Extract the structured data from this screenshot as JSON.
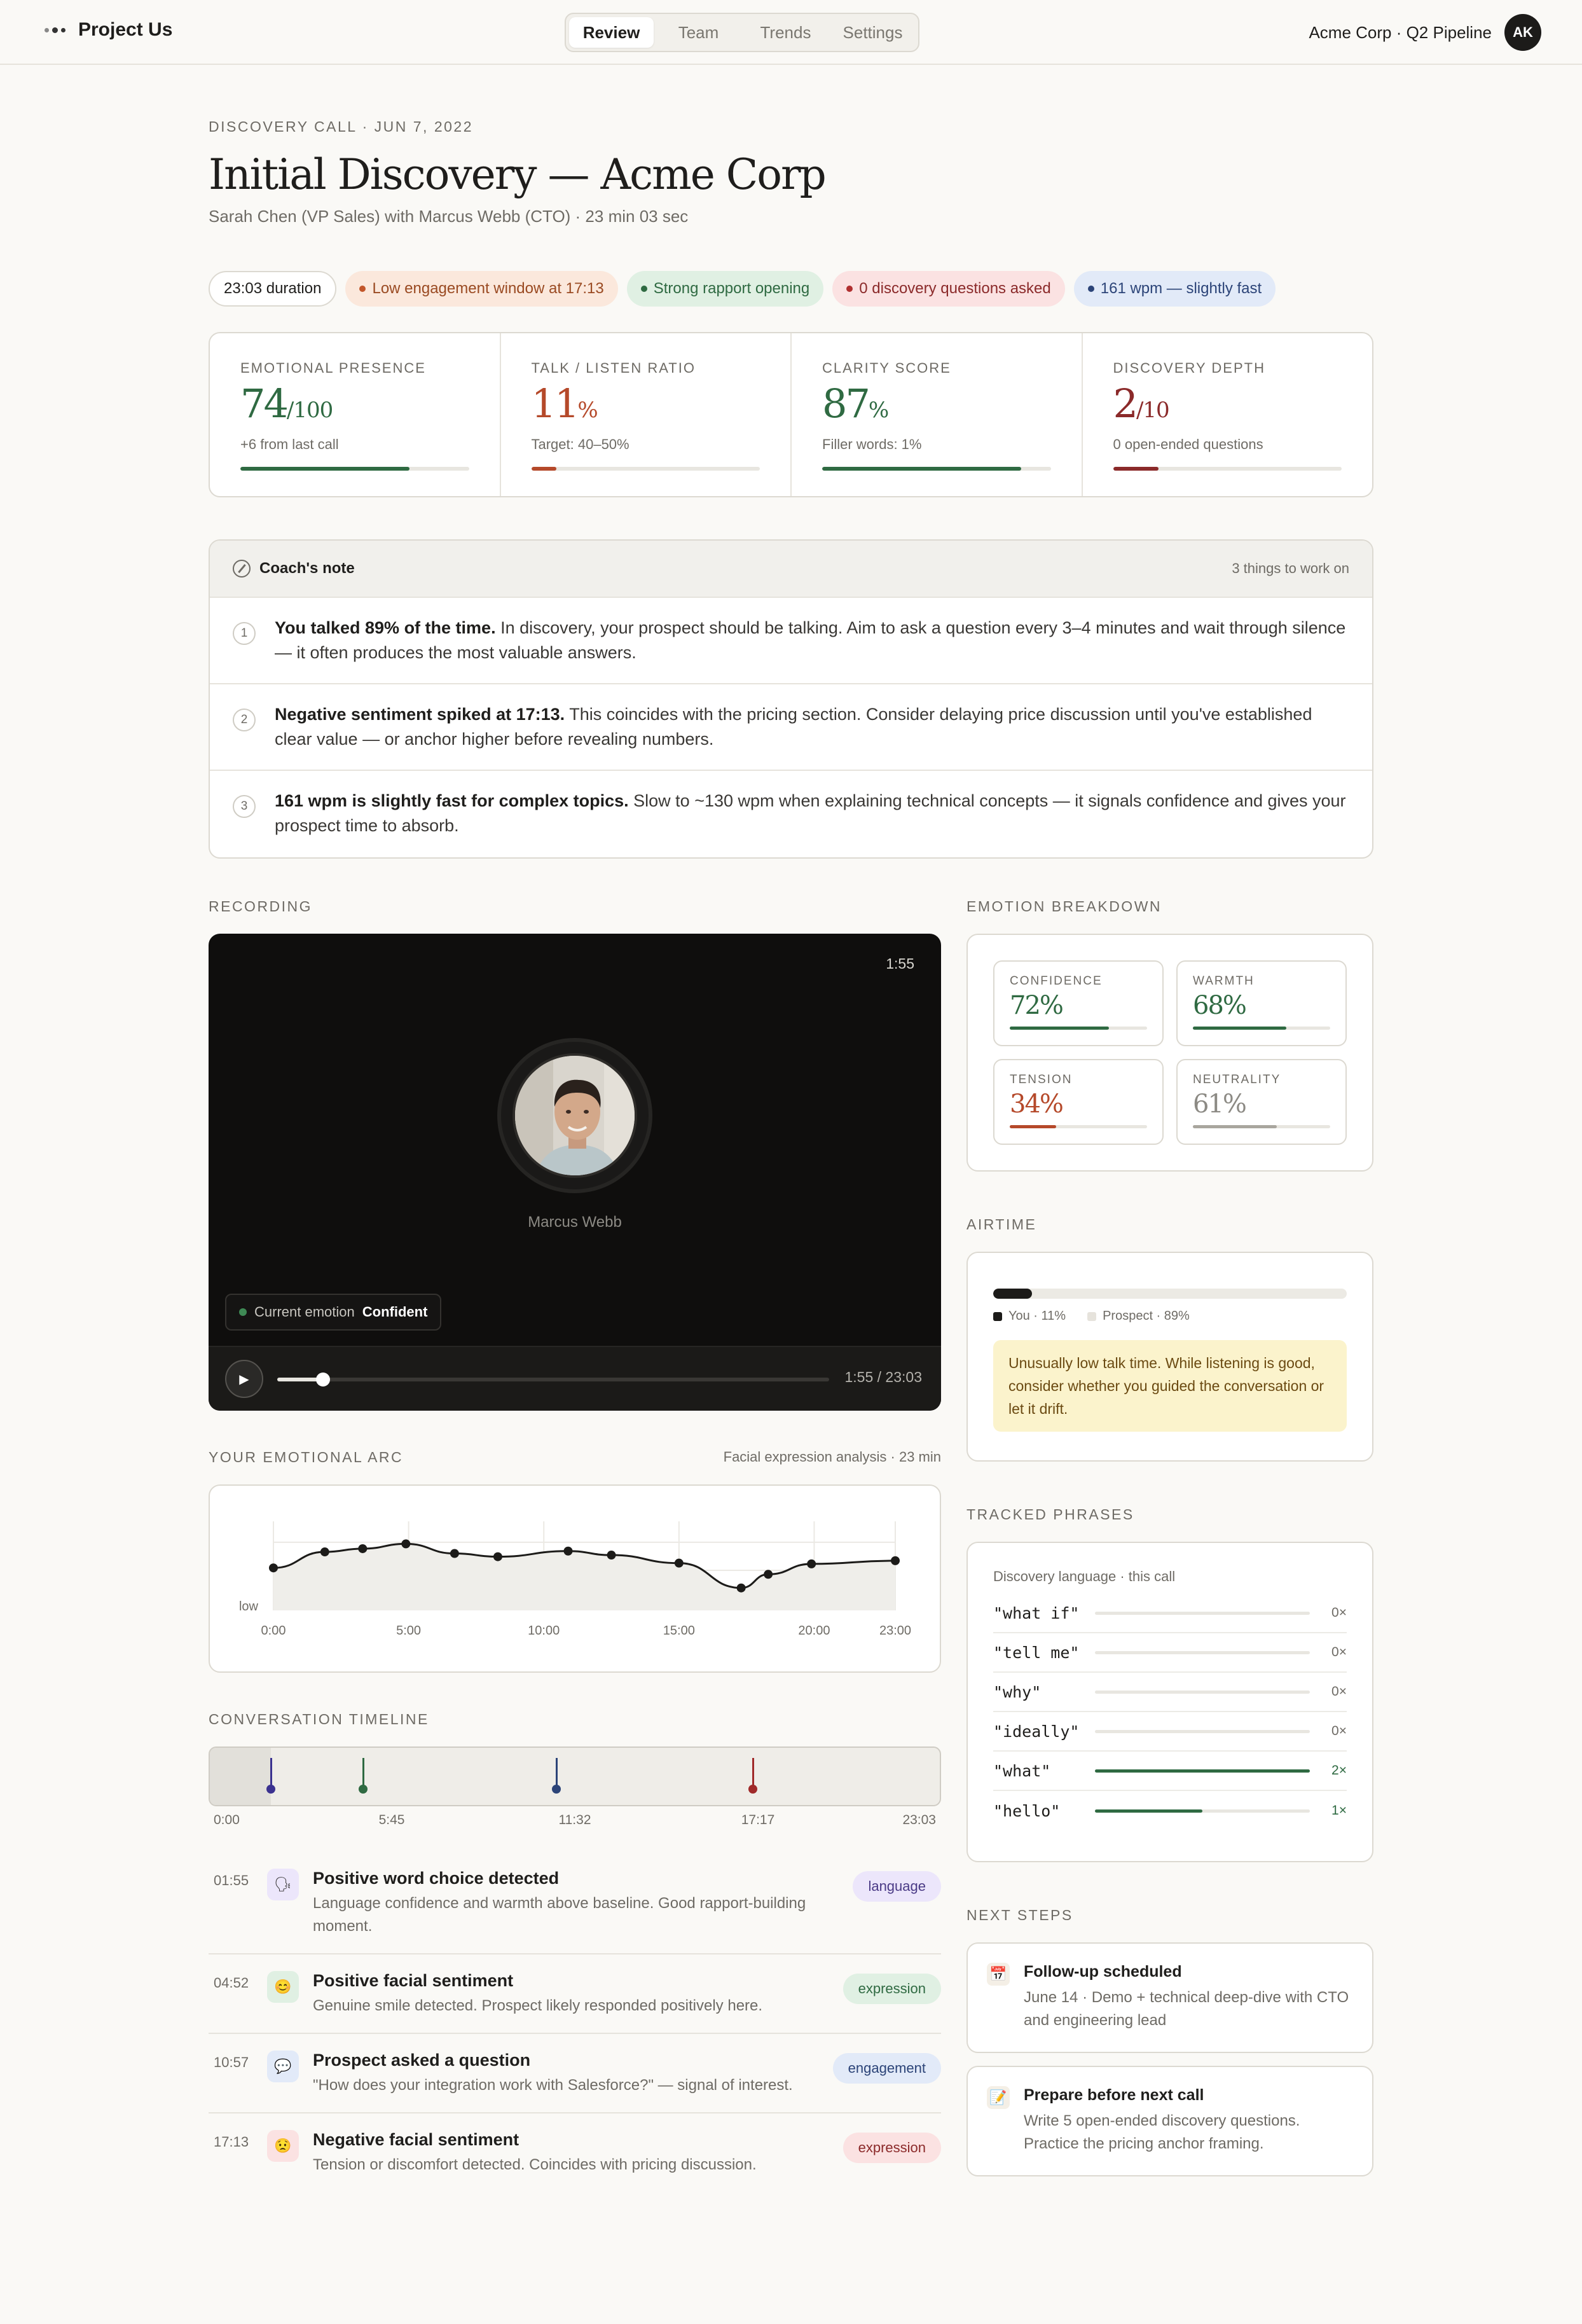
{
  "app": {
    "name": "Project Us",
    "crumb": "Acme Corp · Q2 Pipeline",
    "avatar": "AK"
  },
  "nav": {
    "tabs": [
      "Review",
      "Team",
      "Trends",
      "Settings"
    ],
    "active": "Review"
  },
  "header": {
    "eyebrow": "DISCOVERY CALL · JUN 7, 2022",
    "title": "Initial Discovery — Acme Corp",
    "subtitle": "Sarah Chen (VP Sales) with Marcus Webb (CTO) · 23 min 03 sec"
  },
  "pills": [
    {
      "label": "23:03 duration",
      "style": "plain"
    },
    {
      "label": "Low engagement window at 17:13",
      "style": "orange"
    },
    {
      "label": "Strong rapport opening",
      "style": "green"
    },
    {
      "label": "0 discovery questions asked",
      "style": "red"
    },
    {
      "label": "161 wpm — slightly fast",
      "style": "blue"
    }
  ],
  "metrics": [
    {
      "label": "EMOTIONAL PRESENCE",
      "value": "74",
      "unit": "/100",
      "sub": "+6 from last call",
      "color": "#2f6a42",
      "fill": 0.74
    },
    {
      "label": "TALK / LISTEN RATIO",
      "value": "11",
      "unit": "%",
      "sub": "Target: 40–50%",
      "color": "#b5492a",
      "fill": 0.11
    },
    {
      "label": "CLARITY SCORE",
      "value": "87",
      "unit": "%",
      "sub": "Filler words: 1%",
      "color": "#2f6a42",
      "fill": 0.87
    },
    {
      "label": "DISCOVERY DEPTH",
      "value": "2",
      "unit": "/10",
      "sub": "0 open-ended questions",
      "color": "#8b2a2a",
      "fill": 0.2
    }
  ],
  "coach": {
    "title": "Coach's note",
    "count": "3 things to work on",
    "tips": [
      {
        "num": "1",
        "bold": "You talked 89% of the time.",
        "text": " In discovery, your prospect should be talking. Aim to ask a question every 3–4 minutes and wait through silence — it often produces the most valuable answers."
      },
      {
        "num": "2",
        "bold": "Negative sentiment spiked at 17:13.",
        "text": " This coincides with the pricing section. Consider delaying price discussion until you've established clear value — or anchor higher before revealing numbers."
      },
      {
        "num": "3",
        "bold": "161 wpm is slightly fast for complex topics.",
        "text": " Slow to ~130 wpm when explaining technical concepts — it signals confidence and gives your prospect time to absorb."
      }
    ]
  },
  "recording": {
    "heading": "RECORDING",
    "corner_time": "1:55",
    "person": "Marcus Webb",
    "emotion_label": "Current emotion",
    "emotion_value": "Confident",
    "time_display": "1:55 / 23:03",
    "progress": 0.083
  },
  "arc": {
    "heading": "YOUR EMOTIONAL ARC",
    "aux": "Facial expression analysis · 23 min",
    "ylabel": "low"
  },
  "chart_data": {
    "type": "line",
    "title": "",
    "xlabel": "",
    "ylabel": "low",
    "x_ticks": [
      "0:00",
      "5:00",
      "10:00",
      "15:00",
      "20:00",
      "23:00"
    ],
    "xlim": [
      0,
      23
    ],
    "ylim": [
      0,
      1
    ],
    "x": [
      0,
      1.9,
      3.3,
      4.9,
      6.7,
      8.3,
      10.9,
      12.5,
      15.0,
      17.3,
      18.3,
      19.9,
      23.0
    ],
    "values": [
      0.53,
      0.73,
      0.77,
      0.83,
      0.71,
      0.67,
      0.74,
      0.69,
      0.59,
      0.28,
      0.45,
      0.58,
      0.62
    ]
  },
  "timeline": {
    "heading": "CONVERSATION TIMELINE",
    "labels": [
      "0:00",
      "5:45",
      "11:32",
      "17:17",
      "23:03"
    ],
    "markers": [
      {
        "pos": 0.084,
        "color": "#3b3290"
      },
      {
        "pos": 0.21,
        "color": "#2f6a42"
      },
      {
        "pos": 0.475,
        "color": "#2c4478"
      },
      {
        "pos": 0.744,
        "color": "#a02a2a"
      }
    ],
    "events": [
      {
        "time": "01:55",
        "icon": "speech-icon",
        "glyph": "🗣",
        "bg": "#ece6fb",
        "title": "Positive word choice detected",
        "desc": "Language confidence and warmth above baseline. Good rapport-building moment.",
        "tag": "language",
        "tagstyle": "t-lang"
      },
      {
        "time": "04:52",
        "icon": "smile-icon",
        "glyph": "😊",
        "bg": "#e0f0e3",
        "title": "Positive facial sentiment",
        "desc": "Genuine smile detected. Prospect likely responded positively here.",
        "tag": "expression",
        "tagstyle": "t-exp"
      },
      {
        "time": "10:57",
        "icon": "chat-icon",
        "glyph": "💬",
        "bg": "#e2eaf8",
        "title": "Prospect asked a question",
        "desc": "\"How does your integration work with Salesforce?\" — signal of interest.",
        "tag": "engagement",
        "tagstyle": "t-eng"
      },
      {
        "time": "17:13",
        "icon": "frown-icon",
        "glyph": "😟",
        "bg": "#fbe2e2",
        "title": "Negative facial sentiment",
        "desc": "Tension or discomfort detected. Coincides with pricing discussion.",
        "tag": "expression",
        "tagstyle": "t-expr"
      }
    ]
  },
  "emotions": {
    "heading": "EMOTION BREAKDOWN",
    "items": [
      {
        "label": "CONFIDENCE",
        "value": "72%",
        "fill": 0.72,
        "color": "#2f6a42"
      },
      {
        "label": "WARMTH",
        "value": "68%",
        "fill": 0.68,
        "color": "#2f6a42"
      },
      {
        "label": "TENSION",
        "value": "34%",
        "fill": 0.34,
        "color": "#b5492a"
      },
      {
        "label": "NEUTRALITY",
        "value": "61%",
        "fill": 0.61,
        "color": "#a9a69e"
      }
    ]
  },
  "airtime": {
    "heading": "AIRTIME",
    "you": "You · 11%",
    "prospect": "Prospect · 89%",
    "you_fill": 0.11,
    "warning": "Unusually low talk time. While listening is good, consider whether you guided the conversation or let it drift."
  },
  "phrases": {
    "heading": "TRACKED PHRASES",
    "sub": "Discovery language · this call",
    "items": [
      {
        "word": "\"what if\"",
        "count": "0×",
        "fill": 0
      },
      {
        "word": "\"tell me\"",
        "count": "0×",
        "fill": 0
      },
      {
        "word": "\"why\"",
        "count": "0×",
        "fill": 0
      },
      {
        "word": "\"ideally\"",
        "count": "0×",
        "fill": 0
      },
      {
        "word": "\"what\"",
        "count": "2×",
        "fill": 1.0
      },
      {
        "word": "\"hello\"",
        "count": "1×",
        "fill": 0.5
      }
    ]
  },
  "next_steps": {
    "heading": "NEXT STEPS",
    "items": [
      {
        "icon": "calendar-icon",
        "glyph": "📅",
        "title": "Follow-up scheduled",
        "desc": "June 14 · Demo + technical deep-dive with CTO and engineering lead"
      },
      {
        "icon": "memo-icon",
        "glyph": "📝",
        "title": "Prepare before next call",
        "desc": "Write 5 open-ended discovery questions. Practice the pricing anchor framing."
      }
    ]
  }
}
